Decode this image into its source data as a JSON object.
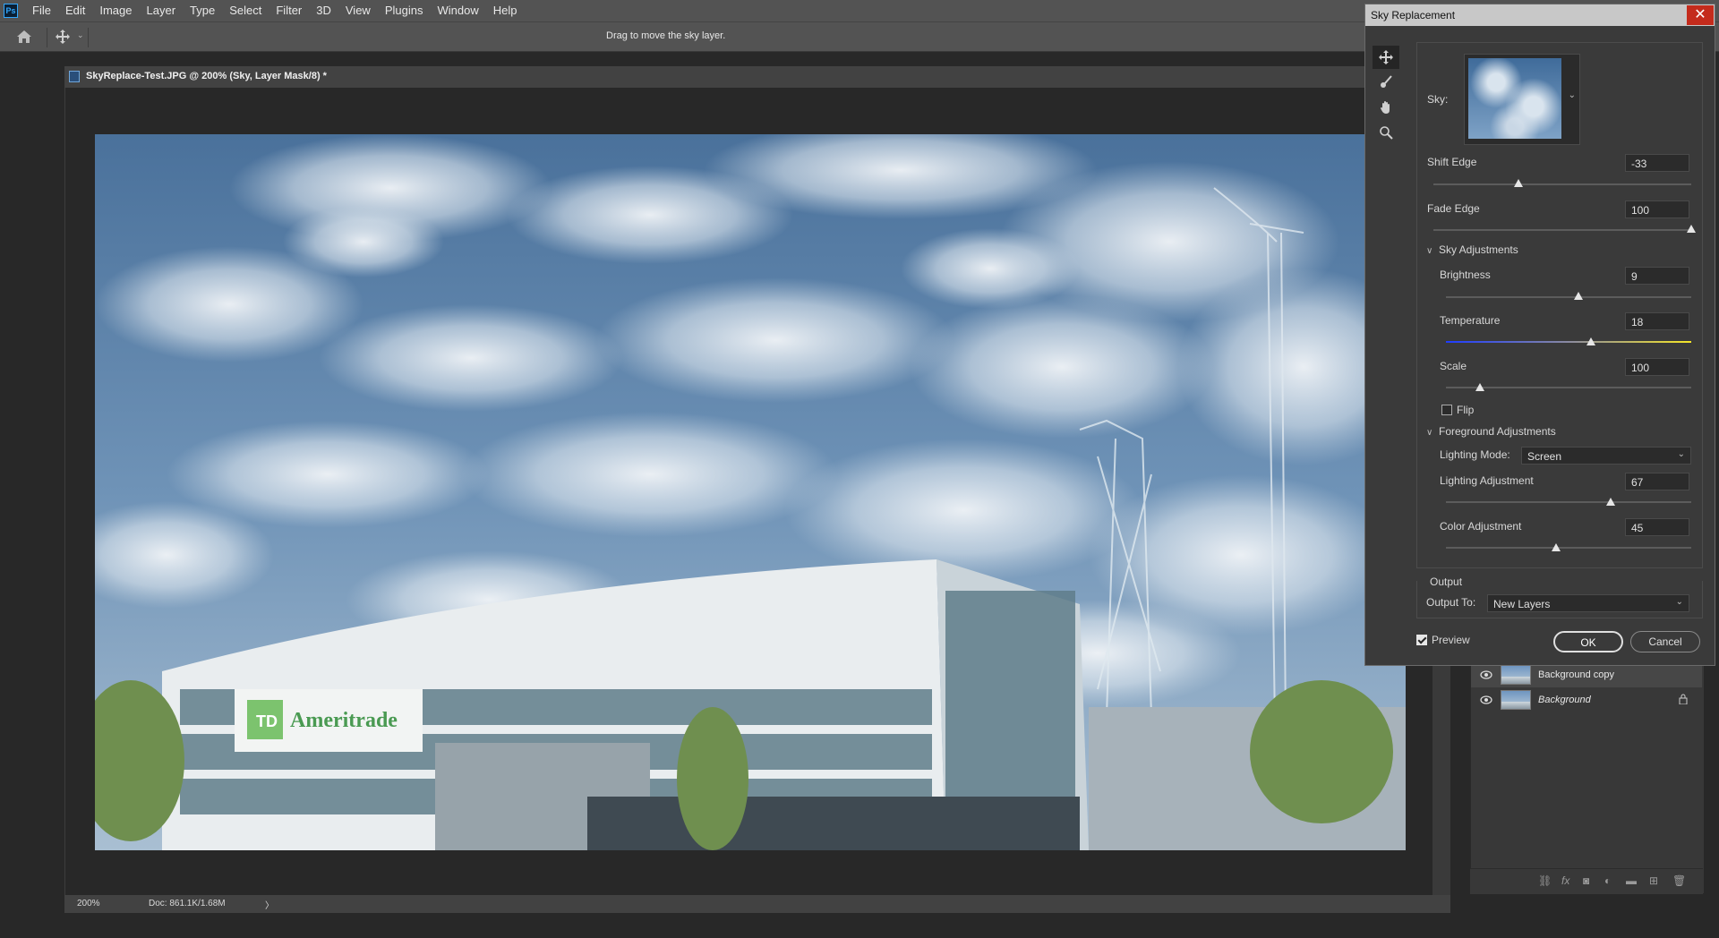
{
  "menubar": {
    "app_icon": "Ps",
    "items": [
      "File",
      "Edit",
      "Image",
      "Layer",
      "Type",
      "Select",
      "Filter",
      "3D",
      "View",
      "Plugins",
      "Window",
      "Help"
    ]
  },
  "optionsbar": {
    "hint": "Drag to move the sky layer."
  },
  "document": {
    "tab_title": "SkyReplace-Test.JPG @ 200% (Sky, Layer Mask/8) *",
    "status_zoom": "200%",
    "status_doc": "Doc: 861.1K/1.68M",
    "status_arrow": "〉",
    "sign_text": "Ameritrade",
    "sign_logo": "TD"
  },
  "layers": {
    "items": [
      {
        "name": "Background copy",
        "visible": true,
        "locked": false
      },
      {
        "name": "Background",
        "visible": true,
        "locked": true
      }
    ]
  },
  "dialog": {
    "title": "Sky Replacement",
    "close": "✕",
    "sky_label": "Sky:",
    "shift_edge": {
      "label": "Shift Edge",
      "value": "-33",
      "fraction": 0.33
    },
    "fade_edge": {
      "label": "Fade Edge",
      "value": "100",
      "fraction": 1.0
    },
    "sky_adjustments": {
      "header": "Sky Adjustments",
      "brightness": {
        "label": "Brightness",
        "value": "9",
        "fraction": 0.54
      },
      "temperature": {
        "label": "Temperature",
        "value": "18",
        "fraction": 0.59
      },
      "scale": {
        "label": "Scale",
        "value": "100",
        "fraction": 0.14
      },
      "flip_label": "Flip",
      "flip_checked": false
    },
    "foreground_adjustments": {
      "header": "Foreground Adjustments",
      "lighting_mode_label": "Lighting Mode:",
      "lighting_mode_value": "Screen",
      "lighting_adjustment": {
        "label": "Lighting Adjustment",
        "value": "67",
        "fraction": 0.67
      },
      "color_adjustment": {
        "label": "Color Adjustment",
        "value": "45",
        "fraction": 0.45
      }
    },
    "output": {
      "header": "Output",
      "output_to_label": "Output To:",
      "output_to_value": "New Layers"
    },
    "preview_label": "Preview",
    "preview_checked": true,
    "ok_label": "OK",
    "cancel_label": "Cancel"
  },
  "colors": {
    "accent": "#31a8ff",
    "close_red": "#c42b1c"
  }
}
